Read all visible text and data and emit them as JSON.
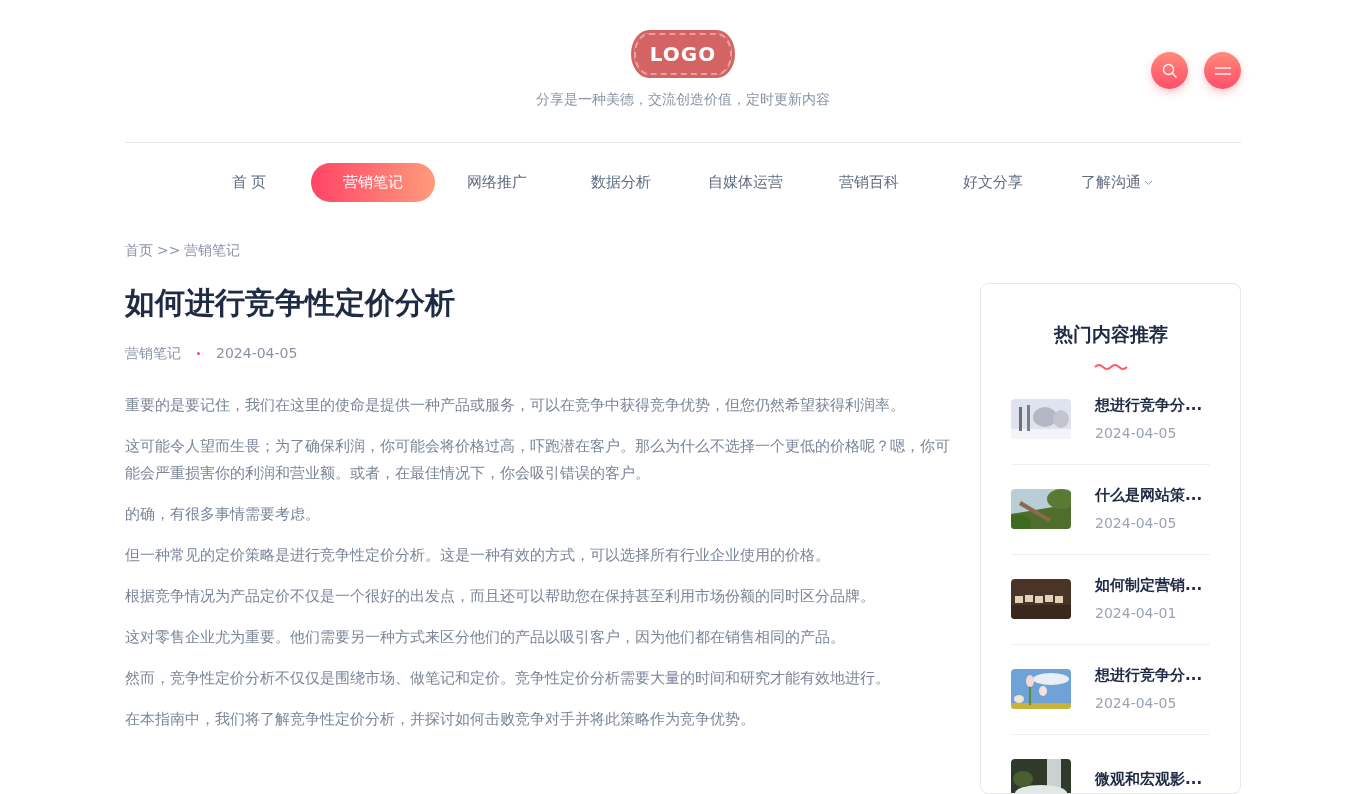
{
  "header": {
    "logo": "LOGO",
    "tagline": "分享是一种美德，交流创造价值，定时更新内容"
  },
  "nav": [
    {
      "label": "首 页",
      "selected": false,
      "dropdown": false
    },
    {
      "label": "营销笔记",
      "selected": true,
      "dropdown": false
    },
    {
      "label": "网络推广",
      "selected": false,
      "dropdown": false
    },
    {
      "label": "数据分析",
      "selected": false,
      "dropdown": false
    },
    {
      "label": "自媒体运营",
      "selected": false,
      "dropdown": false
    },
    {
      "label": "营销百科",
      "selected": false,
      "dropdown": false
    },
    {
      "label": "好文分享",
      "selected": false,
      "dropdown": false
    },
    {
      "label": "了解沟通",
      "selected": false,
      "dropdown": true
    }
  ],
  "breadcrumb": [
    "首页",
    ">>",
    "营销笔记"
  ],
  "article": {
    "title": "如何进行竞争性定价分析",
    "category": "营销笔记",
    "date": "2024-04-05",
    "paragraphs": [
      "重要的是要记住，我们在这里的使命是提供一种产品或服务，可以在竞争中获得竞争优势，但您仍然希望获得利润率。",
      "这可能令人望而生畏；为了确保利润，你可能会将价格过高，吓跑潜在客户。那么为什么不选择一个更低的价格呢？嗯，你可能会严重损害你的利润和营业额。或者，在最佳情况下，你会吸引错误的客户。",
      "的确，有很多事情需要考虑。",
      "但一种常见的定价策略是进行竞争性定价分析。这是一种有效的方式，可以选择所有行业企业使用的价格。",
      "根据竞争情况为产品定价不仅是一个很好的出发点，而且还可以帮助您在保持甚至利用市场份额的同时区分品牌。",
      "这对零售企业尤为重要。他们需要另一种方式来区分他们的产品以吸引客户，因为他们都在销售相同的产品。",
      "然而，竞争性定价分析不仅仅是围绕市场、做笔记和定价。竞争性定价分析需要大量的时间和研究才能有效地进行。",
      "在本指南中，我们将了解竞争性定价分析，并探讨如何击败竞争对手并将此策略作为竞争优势。"
    ]
  },
  "sidebar": {
    "title": "热门内容推荐",
    "items": [
      {
        "title": "想进行竞争分...",
        "date": "2024-04-05"
      },
      {
        "title": "什么是网站策...",
        "date": "2024-04-05"
      },
      {
        "title": "如何制定营销...",
        "date": "2024-04-01"
      },
      {
        "title": "想进行竞争分...",
        "date": "2024-04-05"
      },
      {
        "title": "微观和宏观影..."
      }
    ]
  }
}
